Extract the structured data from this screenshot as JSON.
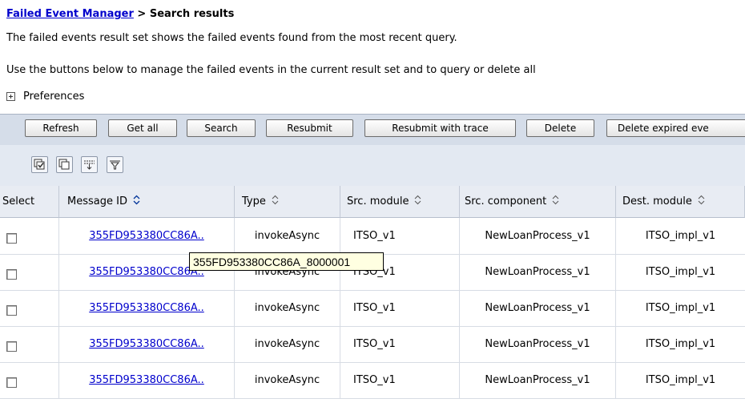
{
  "breadcrumb": {
    "link": "Failed Event Manager",
    "separator": " > ",
    "current": "Search results"
  },
  "descriptions": [
    "The failed events result set shows the failed events found from the most recent query.",
    "Use the buttons below to manage the failed events in the current result set and to query or delete all"
  ],
  "preferences": {
    "label": "Preferences",
    "icon": "expand-plus-icon"
  },
  "toolbar": {
    "buttons": [
      "Refresh",
      "Get all",
      "Search",
      "Resubmit",
      "Resubmit with trace",
      "Delete",
      "Delete expired eve"
    ]
  },
  "icon_toolbar": {
    "icons": [
      "select-all-icon",
      "deselect-all-icon",
      "expand-filter-icon",
      "collapse-filter-icon"
    ]
  },
  "table": {
    "columns": [
      "Select",
      "Message ID",
      "Type",
      "Src. module",
      "Src. component",
      "Dest. module"
    ],
    "sortable": [
      "Message ID",
      "Type",
      "Src. module",
      "Src. component",
      "Dest. module"
    ],
    "rows": [
      {
        "message_id": "355FD953380CC86A..",
        "type": "invokeAsync",
        "src_module": "ITSO_v1",
        "src_component": "NewLoanProcess_v1",
        "dest_module": "ITSO_impl_v1"
      },
      {
        "message_id": "355FD953380CC86A..",
        "type": "invokeAsync",
        "src_module": "ITSO_v1",
        "src_component": "NewLoanProcess_v1",
        "dest_module": "ITSO_impl_v1"
      },
      {
        "message_id": "355FD953380CC86A..",
        "type": "invokeAsync",
        "src_module": "ITSO_v1",
        "src_component": "NewLoanProcess_v1",
        "dest_module": "ITSO_impl_v1"
      },
      {
        "message_id": "355FD953380CC86A..",
        "type": "invokeAsync",
        "src_module": "ITSO_v1",
        "src_component": "NewLoanProcess_v1",
        "dest_module": "ITSO_impl_v1"
      },
      {
        "message_id": "355FD953380CC86A..",
        "type": "invokeAsync",
        "src_module": "ITSO_v1",
        "src_component": "NewLoanProcess_v1",
        "dest_module": "ITSO_impl_v1"
      }
    ]
  },
  "tooltip": {
    "text": "355FD953380CC86A_8000001"
  },
  "colors": {
    "link": "#0000cc",
    "toolbar_bg": "#d5dde9",
    "iconbar_bg": "#e3e9f2",
    "header_bg": "#e8ecf3",
    "tooltip_bg": "#ffffe1"
  }
}
